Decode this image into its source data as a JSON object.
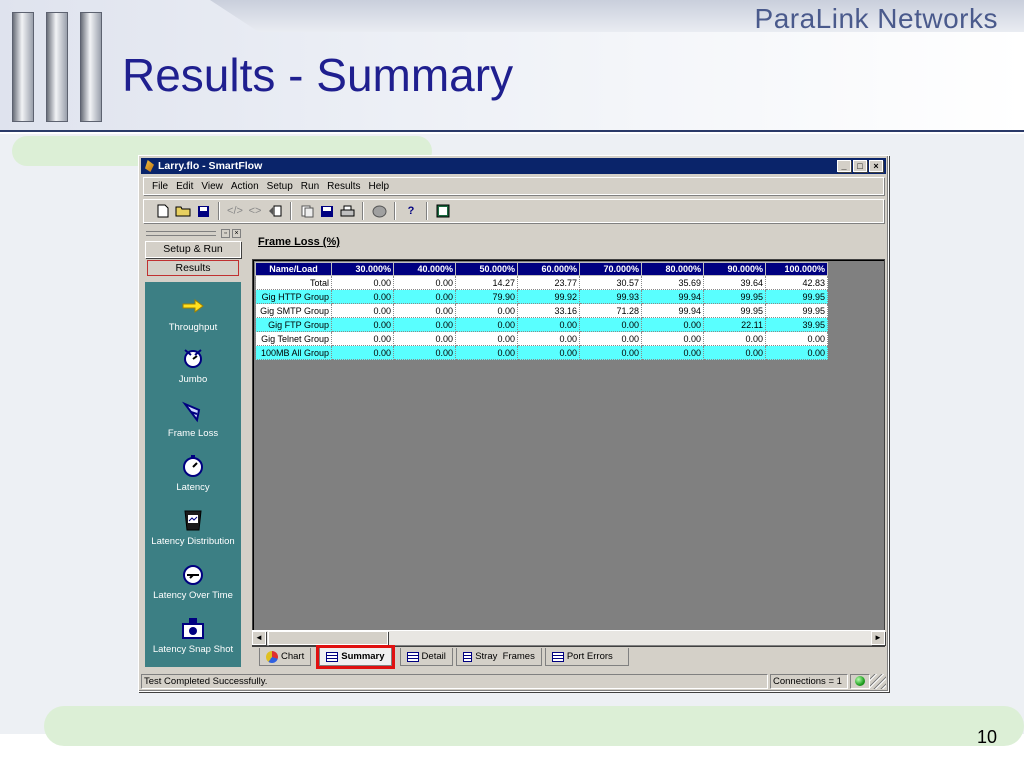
{
  "slide": {
    "brand": "ParaLink Networks",
    "title": "Results - Summary",
    "page_number": "10"
  },
  "window": {
    "title": "Larry.flo - SmartFlow",
    "controls": {
      "minimize": "_",
      "maximize": "□",
      "close": "×"
    }
  },
  "menu": [
    "File",
    "Edit",
    "View",
    "Action",
    "Setup",
    "Run",
    "Results",
    "Help"
  ],
  "toolbar": {
    "icons": [
      "new-file-icon",
      "open-folder-icon",
      "save-disk-icon",
      "step-back-icon",
      "step-forward-icon",
      "load-icon",
      "copy-icon",
      "save-all-icon",
      "print-icon",
      "stop-icon",
      "help-icon",
      "report-icon"
    ]
  },
  "left_panel": {
    "setup_run": "Setup & Run",
    "results": "Results",
    "nav_items": [
      {
        "label": "Throughput",
        "icon": "arrow-icon"
      },
      {
        "label": "Jumbo",
        "icon": "jumbo-icon"
      },
      {
        "label": "Frame Loss",
        "icon": "frame-loss-icon"
      },
      {
        "label": "Latency",
        "icon": "stopwatch-icon"
      },
      {
        "label": "Latency Distribution",
        "icon": "bucket-icon"
      },
      {
        "label": "Latency Over Time",
        "icon": "clock-icon"
      },
      {
        "label": "Latency Snap Shot",
        "icon": "camera-icon"
      }
    ]
  },
  "main": {
    "heading": "Frame Loss (%)",
    "table": {
      "headers": [
        "Name/Load",
        "30.000%",
        "40.000%",
        "50.000%",
        "60.000%",
        "70.000%",
        "80.000%",
        "90.000%",
        "100.000%"
      ],
      "rows": [
        {
          "name": "Total",
          "values": [
            "0.00",
            "0.00",
            "14.27",
            "23.77",
            "30.57",
            "35.69",
            "39.64",
            "42.83"
          ],
          "style": "white"
        },
        {
          "name": "Gig HTTP Group",
          "values": [
            "0.00",
            "0.00",
            "79.90",
            "99.92",
            "99.93",
            "99.94",
            "99.95",
            "99.95"
          ],
          "style": "cyan"
        },
        {
          "name": "Gig SMTP Group",
          "values": [
            "0.00",
            "0.00",
            "0.00",
            "33.16",
            "71.28",
            "99.94",
            "99.95",
            "99.95"
          ],
          "style": "white"
        },
        {
          "name": "Gig FTP Group",
          "values": [
            "0.00",
            "0.00",
            "0.00",
            "0.00",
            "0.00",
            "0.00",
            "22.11",
            "39.95"
          ],
          "style": "cyan"
        },
        {
          "name": "Gig Telnet Group",
          "values": [
            "0.00",
            "0.00",
            "0.00",
            "0.00",
            "0.00",
            "0.00",
            "0.00",
            "0.00"
          ],
          "style": "white"
        },
        {
          "name": "100MB All Group",
          "values": [
            "0.00",
            "0.00",
            "0.00",
            "0.00",
            "0.00",
            "0.00",
            "0.00",
            "0.00"
          ],
          "style": "cyan"
        }
      ]
    },
    "tabs": [
      {
        "label": "Chart",
        "active": false
      },
      {
        "label": "Summary",
        "active": true
      },
      {
        "label": "Detail",
        "active": false
      },
      {
        "label": "Stray  Frames",
        "active": false
      },
      {
        "label": "Port Errors",
        "active": false
      }
    ]
  },
  "status": {
    "message": "Test Completed Successfully.",
    "connections": "Connections = 1",
    "indicator_color": "#20a020"
  }
}
